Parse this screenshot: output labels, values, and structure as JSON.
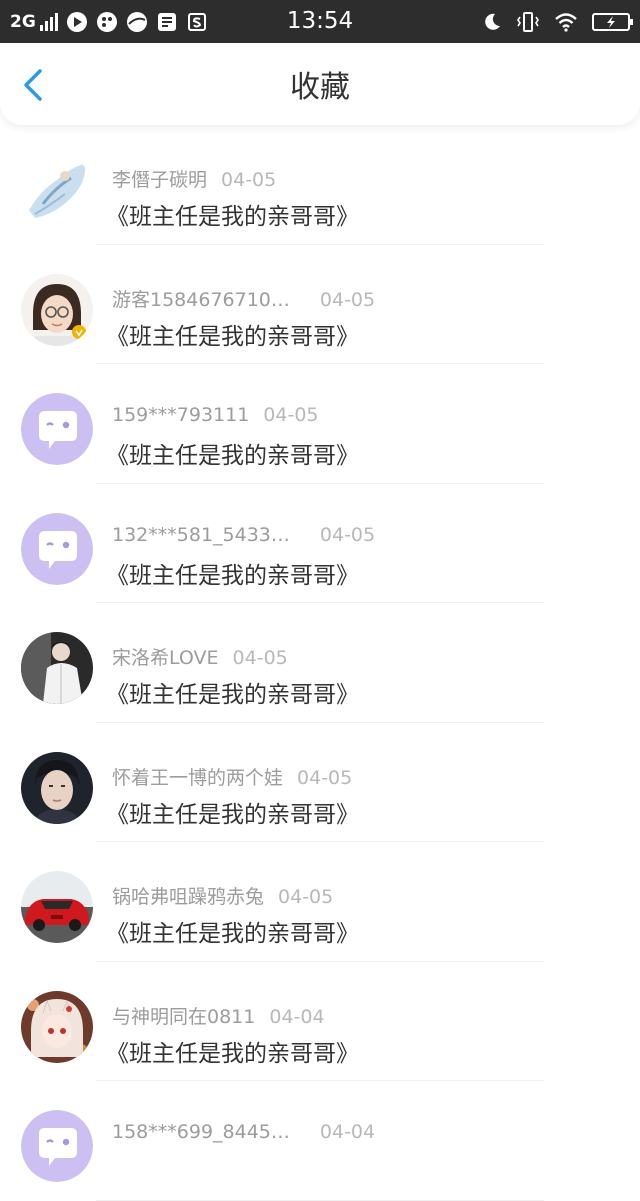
{
  "status": {
    "network": "2G",
    "time": "13:54"
  },
  "header": {
    "title": "收藏"
  },
  "items": [
    {
      "name": "李僭子碳明",
      "date": "04-05",
      "content": "《班主任是我的亲哥哥》",
      "avatar": "anime-figure-avatar"
    },
    {
      "name": "游客1584676710…",
      "date": "04-05",
      "content": "《班主任是我的亲哥哥》",
      "avatar": "girl-glasses-avatar"
    },
    {
      "name": "159***793111",
      "date": "04-05",
      "content": "《班主任是我的亲哥哥》",
      "avatar": "default-chat-avatar"
    },
    {
      "name": "132***581_5433…",
      "date": "04-05",
      "content": "《班主任是我的亲哥哥》",
      "avatar": "default-chat-avatar"
    },
    {
      "name": "宋洛希LOVE",
      "date": "04-05",
      "content": "《班主任是我的亲哥哥》",
      "avatar": "person-white-jacket-avatar"
    },
    {
      "name": "怀着王一博的两个娃",
      "date": "04-05",
      "content": "《班主任是我的亲哥哥》",
      "avatar": "man-portrait-avatar"
    },
    {
      "name": "锅哈弗咀躁鸦赤兔",
      "date": "04-05",
      "content": "《班主任是我的亲哥哥》",
      "avatar": "red-car-avatar"
    },
    {
      "name": "与神明同在0811",
      "date": "04-04",
      "content": "《班主任是我的亲哥哥》",
      "avatar": "anime-girl-avatar"
    },
    {
      "name": "158***699_8445…",
      "date": "04-04",
      "content": "",
      "avatar": "default-chat-avatar"
    }
  ]
}
